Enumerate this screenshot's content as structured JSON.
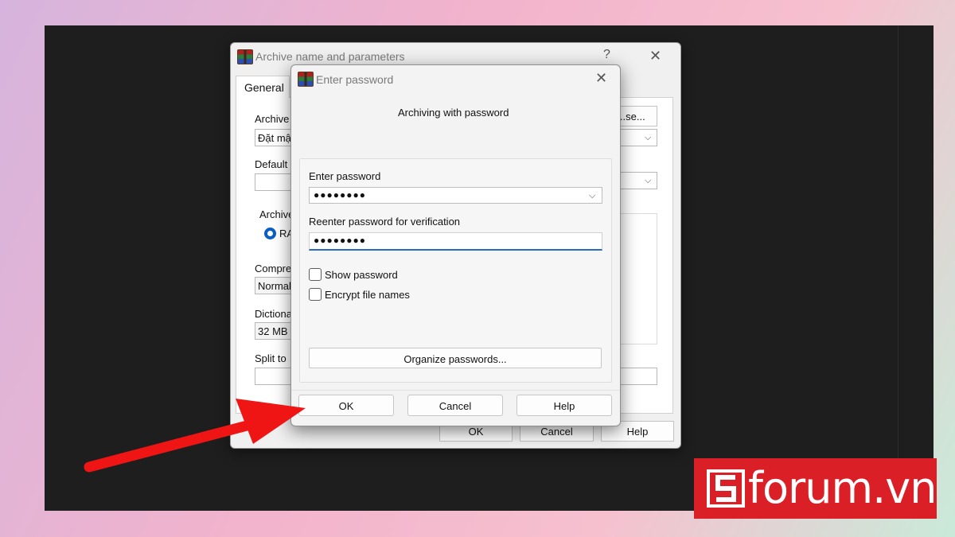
{
  "back_dialog": {
    "title": "Archive name and parameters",
    "help_symbol": "?",
    "close_symbol": "✕",
    "tab_general": "General",
    "label_archive": "Archive",
    "archive_value": "Đặt mậ",
    "browse_label": "...se...",
    "label_default": "Default",
    "label_archive_format": "Archive",
    "radio_rar": "RA",
    "label_compression": "Compre",
    "compression_value": "Normal",
    "label_dictionary": "Dictiona",
    "dictionary_value": "32 MB",
    "label_split": "Split to",
    "ok_label": "OK",
    "cancel_label": "Cancel",
    "help_label": "Help"
  },
  "front_dialog": {
    "title": "Enter password",
    "close_symbol": "✕",
    "caption": "Archiving with password",
    "enter_password_label": "Enter password",
    "password_value": "●●●●●●●●",
    "reenter_label": "Reenter password for verification",
    "reenter_value": "●●●●●●●●",
    "show_password_label": "Show password",
    "encrypt_names_label": "Encrypt file names",
    "organize_label": "Organize passwords...",
    "ok_label": "OK",
    "cancel_label": "Cancel",
    "help_label": "Help"
  },
  "logo": {
    "text": "forum.vn",
    "brand_color": "#db1f26"
  },
  "arrow_color": "#f01515"
}
